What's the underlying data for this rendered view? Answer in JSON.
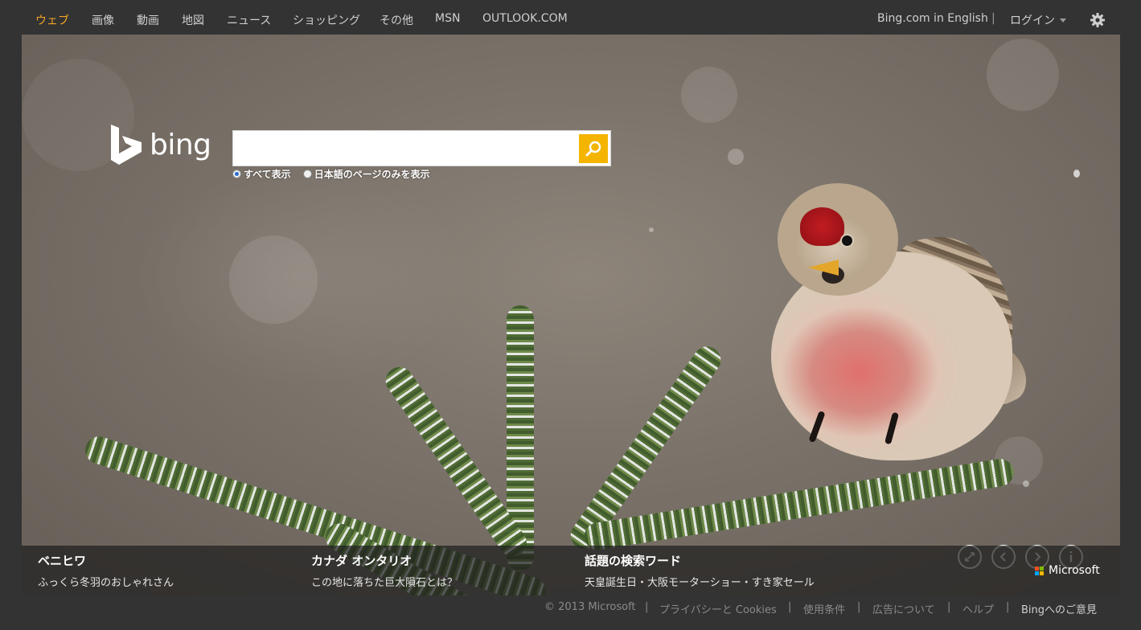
{
  "nav": {
    "items": [
      {
        "label": "ウェブ",
        "active": true
      },
      {
        "label": "画像"
      },
      {
        "label": "動画"
      },
      {
        "label": "地図"
      },
      {
        "label": "ニュース"
      },
      {
        "label": "ショッピング"
      },
      {
        "label": "その他"
      },
      {
        "label": "MSN"
      },
      {
        "label": "OUTLOOK.COM"
      }
    ],
    "english_link": "Bing.com in English",
    "separator": "|",
    "login": "ログイン",
    "settings_icon": "gear-icon"
  },
  "logo": {
    "text": "bing"
  },
  "search": {
    "value": "",
    "placeholder": "",
    "button_icon": "search-icon",
    "options": [
      {
        "label": "すべて表示",
        "checked": true
      },
      {
        "label": "日本語のページのみを表示",
        "checked": false
      }
    ]
  },
  "hero": {
    "controls": [
      {
        "icon": "fullscreen-icon"
      },
      {
        "icon": "previous-icon"
      },
      {
        "icon": "next-icon"
      },
      {
        "icon": "info-icon"
      }
    ]
  },
  "infobar": {
    "cards": [
      {
        "title": "ベニヒワ",
        "subtitle": "ふっくら冬羽のおしゃれさん"
      },
      {
        "title": "カナダ オンタリオ",
        "subtitle": "この地に落ちた巨大隕石とは？"
      },
      {
        "title": "話題の検索ワード",
        "subtitle": "天皇誕生日・大阪モーターショー・すき家セール"
      }
    ],
    "brand": "Microsoft"
  },
  "footer": {
    "copyright": "© 2013 Microsoft",
    "links": [
      "プライバシーと Cookies",
      "使用条件",
      "広告について",
      "ヘルプ"
    ],
    "feedback": "Bingへのご意見",
    "separator": "|"
  },
  "colors": {
    "accent": "#f5a623",
    "search_button": "#f4b400",
    "background": "#333333"
  }
}
